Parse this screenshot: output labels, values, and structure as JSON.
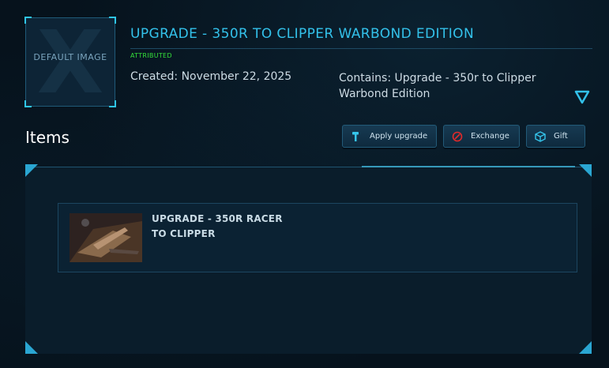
{
  "thumbnail": {
    "placeholder_text": "DEFAULT IMAGE"
  },
  "pledge": {
    "title": "UPGRADE - 350R TO CLIPPER WARBOND EDITION",
    "badge": "ATTRIBUTED",
    "created": "Created: November 22, 2025",
    "contains": "Contains: Upgrade - 350r to Clipper Warbond Edition"
  },
  "items_section": {
    "heading": "Items"
  },
  "actions": {
    "apply_upgrade": "Apply upgrade",
    "exchange": "Exchange",
    "gift": "Gift"
  },
  "items": [
    {
      "name": "UPGRADE - 350R RACER TO CLIPPER",
      "image": "ship-thumbnail"
    }
  ],
  "colors": {
    "accent": "#33c1ea",
    "badge": "#35e03a",
    "background": "#06121c"
  },
  "icons": [
    "expand-icon",
    "hammer-icon",
    "exchange-icon",
    "gift-icon"
  ]
}
